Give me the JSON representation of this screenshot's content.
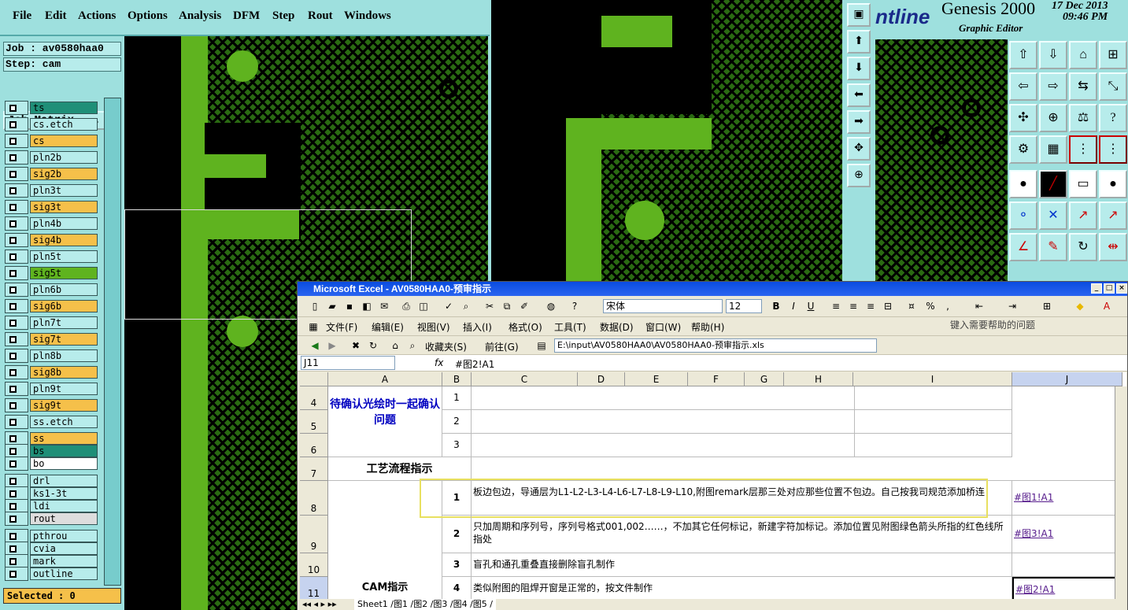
{
  "menu": [
    "File",
    "Edit",
    "Actions",
    "Options",
    "Analysis",
    "DFM",
    "Step",
    "Rout",
    "Windows"
  ],
  "job": {
    "job_label": "Job : av0580haa0",
    "step_label": "Step: cam",
    "matrix_button": "Job Matrix ...",
    "selected": "Selected : 0"
  },
  "layers": [
    {
      "name": "ts",
      "color": "#1f8f78"
    },
    {
      "name": "cs.etch",
      "color": "#b7eceb"
    },
    {
      "name": "cs",
      "color": "#f5c04a"
    },
    {
      "name": "pln2b",
      "color": "#b7eceb"
    },
    {
      "name": "sig2b",
      "color": "#f5c04a"
    },
    {
      "name": "pln3t",
      "color": "#b7eceb"
    },
    {
      "name": "sig3t",
      "color": "#f5c04a"
    },
    {
      "name": "pln4b",
      "color": "#b7eceb"
    },
    {
      "name": "sig4b",
      "color": "#f5c04a"
    },
    {
      "name": "pln5t",
      "color": "#b7eceb"
    },
    {
      "name": "sig5t",
      "color": "#5fb31f"
    },
    {
      "name": "pln6b",
      "color": "#b7eceb"
    },
    {
      "name": "sig6b",
      "color": "#f5c04a"
    },
    {
      "name": "pln7t",
      "color": "#b7eceb"
    },
    {
      "name": "sig7t",
      "color": "#f5c04a"
    },
    {
      "name": "pln8b",
      "color": "#b7eceb"
    },
    {
      "name": "sig8b",
      "color": "#f5c04a"
    },
    {
      "name": "pln9t",
      "color": "#b7eceb"
    },
    {
      "name": "sig9t",
      "color": "#f5c04a"
    },
    {
      "name": "ss.etch",
      "color": "#b7eceb"
    },
    {
      "name": "ss",
      "color": "#f5c04a"
    },
    {
      "name": "bs",
      "color": "#1f8f78"
    },
    {
      "name": "bo",
      "color": "#ffffff"
    },
    {
      "name": "drl",
      "color": "#b7eceb"
    },
    {
      "name": "ks1-3t",
      "color": "#b7eceb"
    },
    {
      "name": "ldi",
      "color": "#b7eceb"
    },
    {
      "name": "rout",
      "color": "#dddddd"
    },
    {
      "name": "pthrou",
      "color": "#b7eceb"
    },
    {
      "name": "cvia",
      "color": "#b7eceb"
    },
    {
      "name": "mark",
      "color": "#b7eceb"
    },
    {
      "name": "outline",
      "color": "#b7eceb"
    }
  ],
  "logo": {
    "brand": "ntline",
    "product": "Genesis 2000",
    "subtitle": "Graphic Editor",
    "date": "17 Dec 2013",
    "time": "09:46 PM"
  },
  "excel": {
    "title": "Microsoft Excel - AV0580HAA0-预审指示",
    "font": "宋体",
    "size": "12",
    "menus": [
      "文件(F)",
      "编辑(E)",
      "视图(V)",
      "插入(I)",
      "格式(O)",
      "工具(T)",
      "数据(D)",
      "窗口(W)",
      "帮助(H)"
    ],
    "help_placeholder": "键入需要帮助的问题",
    "favorites": "收藏夹(S)",
    "goto": "前往(G)",
    "path": "E:\\input\\AV0580HAA0\\AV0580HAA0-预审指示.xls",
    "namebox": "J11",
    "fx": "fx",
    "formula": "#图2!A1",
    "columns": [
      "A",
      "B",
      "C",
      "D",
      "E",
      "F",
      "G",
      "H",
      "I",
      "J"
    ],
    "rows": [
      "4",
      "5",
      "6",
      "7",
      "8",
      "9",
      "10",
      "11"
    ],
    "a_pending": "待确认光绘时一起确认问题",
    "a_flow": "工艺流程指示",
    "a_cam": "CAM指示",
    "b_vals": [
      "1",
      "2",
      "3",
      "1",
      "2",
      "3",
      "4"
    ],
    "c_texts": [
      "板边包边，导通层为L1-L2-L3-L4-L6-L7-L8-L9-L10,附图remark层那三处对应那些位置不包边。自己按我司规范添加桥连",
      "只加周期和序列号，序列号格式001,002……，不加其它任何标记，新建字符加标记。添加位置见附图绿色箭头所指的红色线所指处",
      "盲孔和通孔重叠直接删除盲孔制作",
      "类似附图的阻焊开窗是正常的，按文件制作"
    ],
    "j_links": [
      "#图1!A1",
      "#图3!A1",
      "#图2!A1"
    ],
    "sheets": "Sheet1 /图1 /图2 /图3 /图4 /图5 /"
  }
}
